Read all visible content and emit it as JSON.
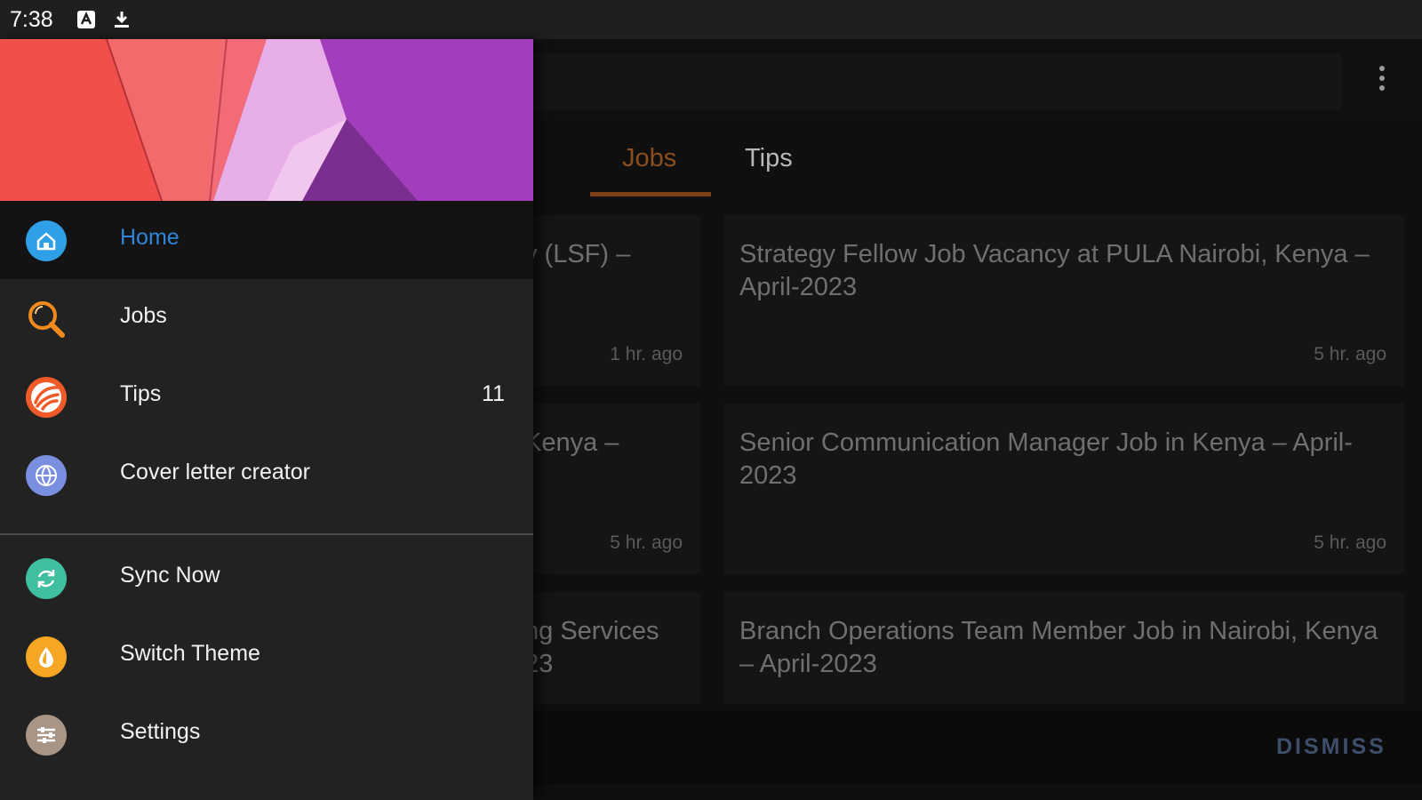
{
  "status_bar": {
    "time": "7:38"
  },
  "tabs": [
    {
      "label": "Jobs",
      "selected": true
    },
    {
      "label": "Tips",
      "selected": false
    }
  ],
  "job_cards_right": [
    {
      "title": "Strategy Fellow Job Vacancy at PULA Nairobi, Kenya – April-2023",
      "time": "5 hr. ago"
    },
    {
      "title": "Senior Communication Manager Job in Kenya – April-2023",
      "time": "5 hr. ago"
    },
    {
      "title": "Branch Operations Team Member Job in Nairobi, Kenya – April-2023",
      "time": ""
    }
  ],
  "job_cards_left_partial": [
    {
      "title": "y (LSF) –",
      "time": "1 hr. ago"
    },
    {
      "title": "Kenya –",
      "time": "5 hr. ago"
    },
    {
      "title": "ng Services\n23",
      "time": ""
    }
  ],
  "snackbar": {
    "action": "DISMISS"
  },
  "drawer": {
    "items": [
      {
        "label": "Home",
        "icon": "home-icon",
        "color": "#2f9fe8",
        "active": true
      },
      {
        "label": "Jobs",
        "icon": "job-search-icon",
        "color": "#f08a1c"
      },
      {
        "label": "Tips",
        "icon": "tips-icon",
        "color": "#f05a28",
        "badge": "11"
      },
      {
        "label": "Cover letter creator",
        "icon": "globe-icon",
        "color": "#7b8fe0"
      }
    ],
    "secondary_items": [
      {
        "label": "Sync Now",
        "icon": "sync-icon",
        "color": "#3fbfa0"
      },
      {
        "label": "Switch Theme",
        "icon": "theme-icon",
        "color": "#f5a623"
      },
      {
        "label": "Settings",
        "icon": "settings-icon",
        "color": "#a89585"
      }
    ]
  },
  "colors": {
    "accent_tab": "#8a4f1d",
    "active_menu": "#2f86d8",
    "drawer_bg": "#222222"
  }
}
